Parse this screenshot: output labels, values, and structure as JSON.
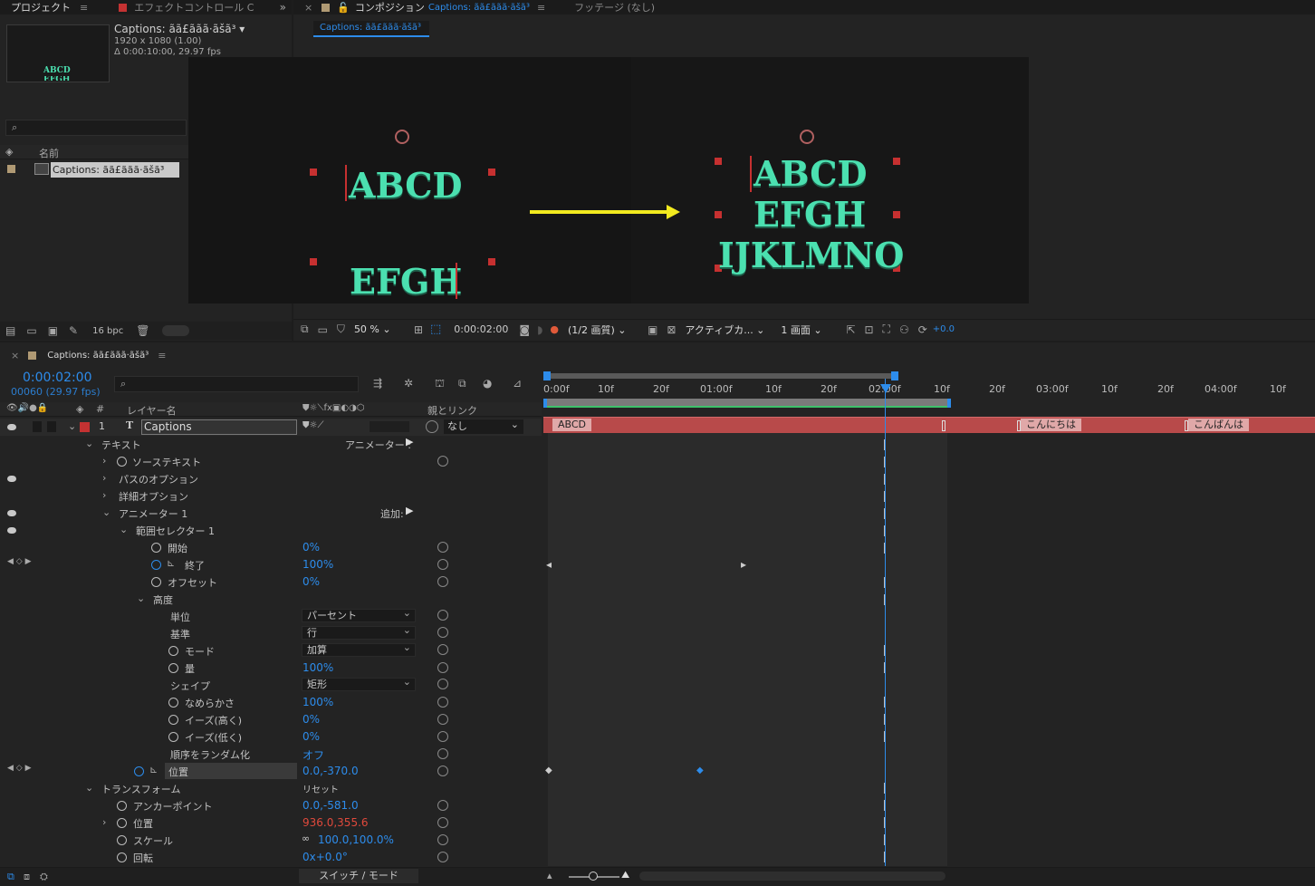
{
  "project_panel": {
    "tab_project": "プロジェクト",
    "tab_effects": "エフェクトコントロール C",
    "comp_name": "Captions: ãã£ããã·ãšã³",
    "comp_size": "1920 x 1080 (1.00)",
    "comp_duration": "Δ 0:00:10:00, 29.97 fps",
    "thumb_line1": "ABCD",
    "thumb_line2": "EFGH",
    "col_name": "名前",
    "item_name": "Captions: ãã£ããã·ãšã³",
    "bpc": "16 bpc"
  },
  "comp_panel": {
    "tab_comp": "コンポジション",
    "tab_comp_name": "Captions: ãã£ããã·ãšã³",
    "tab_footage": "フッテージ (なし)",
    "subtab": "Captions: ãã£ããã·ãšã³",
    "left_line1": "ABCD",
    "left_line2": "EFGH",
    "right_line1": "ABCD",
    "right_line2": "EFGH",
    "right_line3": "IJKLMNO",
    "zoom": "50 %",
    "timecode": "0:00:02:00",
    "resolution": "(1/2 画質)",
    "camera": "アクティブカ...",
    "views": "1 画面",
    "exposure": "+0.0"
  },
  "timeline": {
    "tab_name": "Captions: ãã£ããã·ãšã³",
    "timecode": "0:00:02:00",
    "frame_info": "00060 (29.97 fps)",
    "col_layer_name": "レイヤー名",
    "col_parent": "親とリンク",
    "layer_num": "1",
    "layer_name": "Captions",
    "parent_value": "なし",
    "switch_mode": "スイッチ / モード",
    "ruler": [
      "0:00f",
      "10f",
      "20f",
      "01:00f",
      "10f",
      "20f",
      "02:00f",
      "10f",
      "20f",
      "03:00f",
      "10f",
      "20f",
      "04:00f",
      "10f"
    ],
    "clips": [
      "ABCD",
      "こんにちは",
      "こんばんは"
    ],
    "props": {
      "text": "テキスト",
      "animator_label": "アニメーター :",
      "source_text": "ソーステキスト",
      "path_options": "パスのオプション",
      "more_options": "詳細オプション",
      "animator1": "アニメーター 1",
      "add_label": "追加:",
      "range_selector": "範囲セレクター 1",
      "start": "開始",
      "start_val": "0%",
      "end": "終了",
      "end_val": "100%",
      "offset": "オフセット",
      "offset_val": "0%",
      "advanced": "高度",
      "units": "単位",
      "units_val": "パーセント",
      "based_on": "基準",
      "based_on_val": "行",
      "mode": "モード",
      "mode_val": "加算",
      "amount": "量",
      "amount_val": "100%",
      "shape": "シェイプ",
      "shape_val": "矩形",
      "smoothness": "なめらかさ",
      "smoothness_val": "100%",
      "ease_high": "イーズ(高く)",
      "ease_high_val": "0%",
      "ease_low": "イーズ(低く)",
      "ease_low_val": "0%",
      "randomize": "順序をランダム化",
      "randomize_val": "オフ",
      "position": "位置",
      "position_val": "0.0,-370.0",
      "transform": "トランスフォーム",
      "reset": "リセット",
      "anchor_point": "アンカーポイント",
      "anchor_point_val": "0.0,-581.0",
      "position2": "位置",
      "position2_val": "936.0,355.6",
      "scale": "スケール",
      "scale_val": "100.0,100.0%",
      "rotation": "回転",
      "rotation_val": "0x+0.0°"
    }
  }
}
